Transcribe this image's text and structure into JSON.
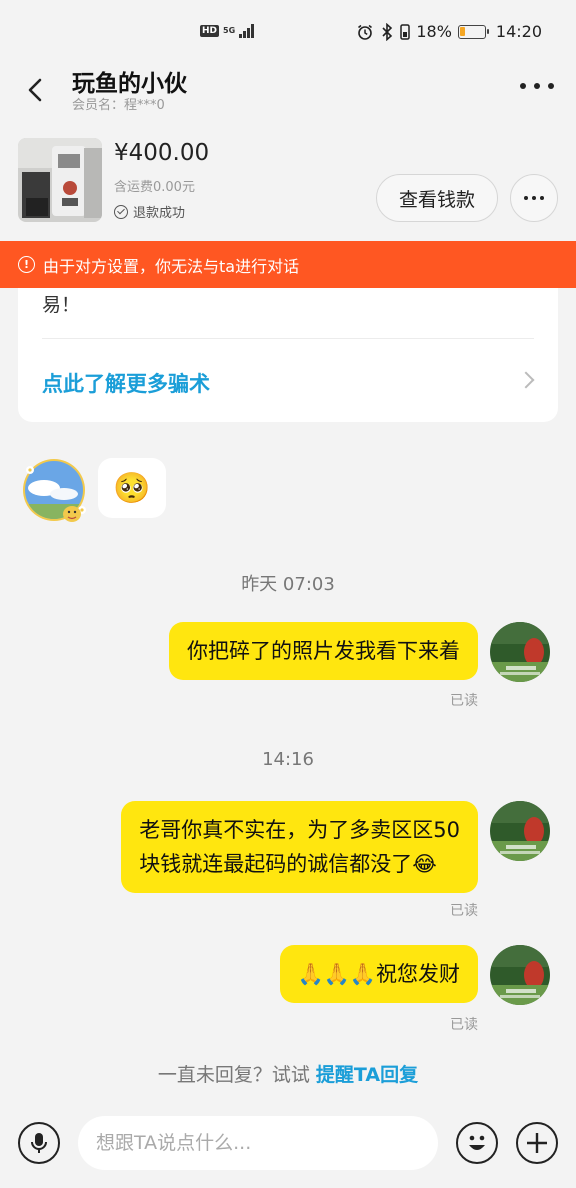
{
  "status_bar": {
    "hd": "HD",
    "net": "5G",
    "battery": "18%",
    "time": "14:20",
    "battery_level": 0.18
  },
  "header": {
    "title": "玩鱼的小伙",
    "subtitle": "会员名：程***0"
  },
  "product": {
    "price": "¥400.00",
    "shipping": "含运费0.00元",
    "refund_status": "退款成功",
    "view_money_label": "查看钱款"
  },
  "banner": {
    "text": "由于对方设置，你无法与ta进行对话"
  },
  "scam_card": {
    "text": "易！",
    "link": "点此了解更多骗术"
  },
  "messages": {
    "emoji_reply": "🥺",
    "time1": "昨天 07:03",
    "msg1": "你把碎了的照片发我看下来着",
    "read1": "已读",
    "time2": "14:16",
    "msg2_line1": "老哥你真不实在，为了多卖区区50",
    "msg2_line2": "块钱就连最起码的诚信都没了😂",
    "read2": "已读",
    "msg3": "🙏🙏🙏祝您发财",
    "read3": "已读"
  },
  "hint": {
    "prefix": "一直未回复？试试 ",
    "action": "提醒TA回复"
  },
  "input": {
    "placeholder": "想跟TA说点什么..."
  },
  "colors": {
    "accent": "#ff5722",
    "bubble": "#ffe60f",
    "link": "#1b9ed8"
  }
}
